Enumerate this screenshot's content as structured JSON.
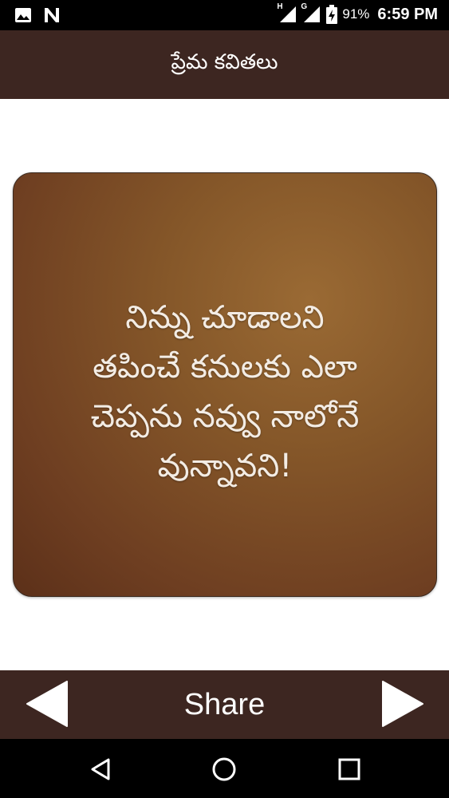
{
  "status_bar": {
    "battery_percent": "91%",
    "time": "6:59 PM",
    "network_1": "H",
    "network_2": "G",
    "icons": [
      "gallery-icon",
      "n-notification-icon",
      "signal-icon",
      "signal-icon",
      "battery-charging-icon"
    ]
  },
  "app_bar": {
    "title": "ప్రేమ కవితలు"
  },
  "quote": {
    "lines": [
      "నిన్ను చూడాలని",
      "తపించే కనులకు ఎలా",
      "చెప్పను నవ్వు నాలోనే",
      "వున్నావని!"
    ]
  },
  "bottom_bar": {
    "share_label": "Share",
    "prev_icon": "arrow-left-icon",
    "next_icon": "arrow-right-icon"
  },
  "system_nav": {
    "icons": [
      "back-icon",
      "home-icon",
      "recents-icon"
    ]
  },
  "colors": {
    "bar_background": "#3d2621",
    "card_brown": "#855729",
    "text_on_bar": "#ffffff"
  }
}
